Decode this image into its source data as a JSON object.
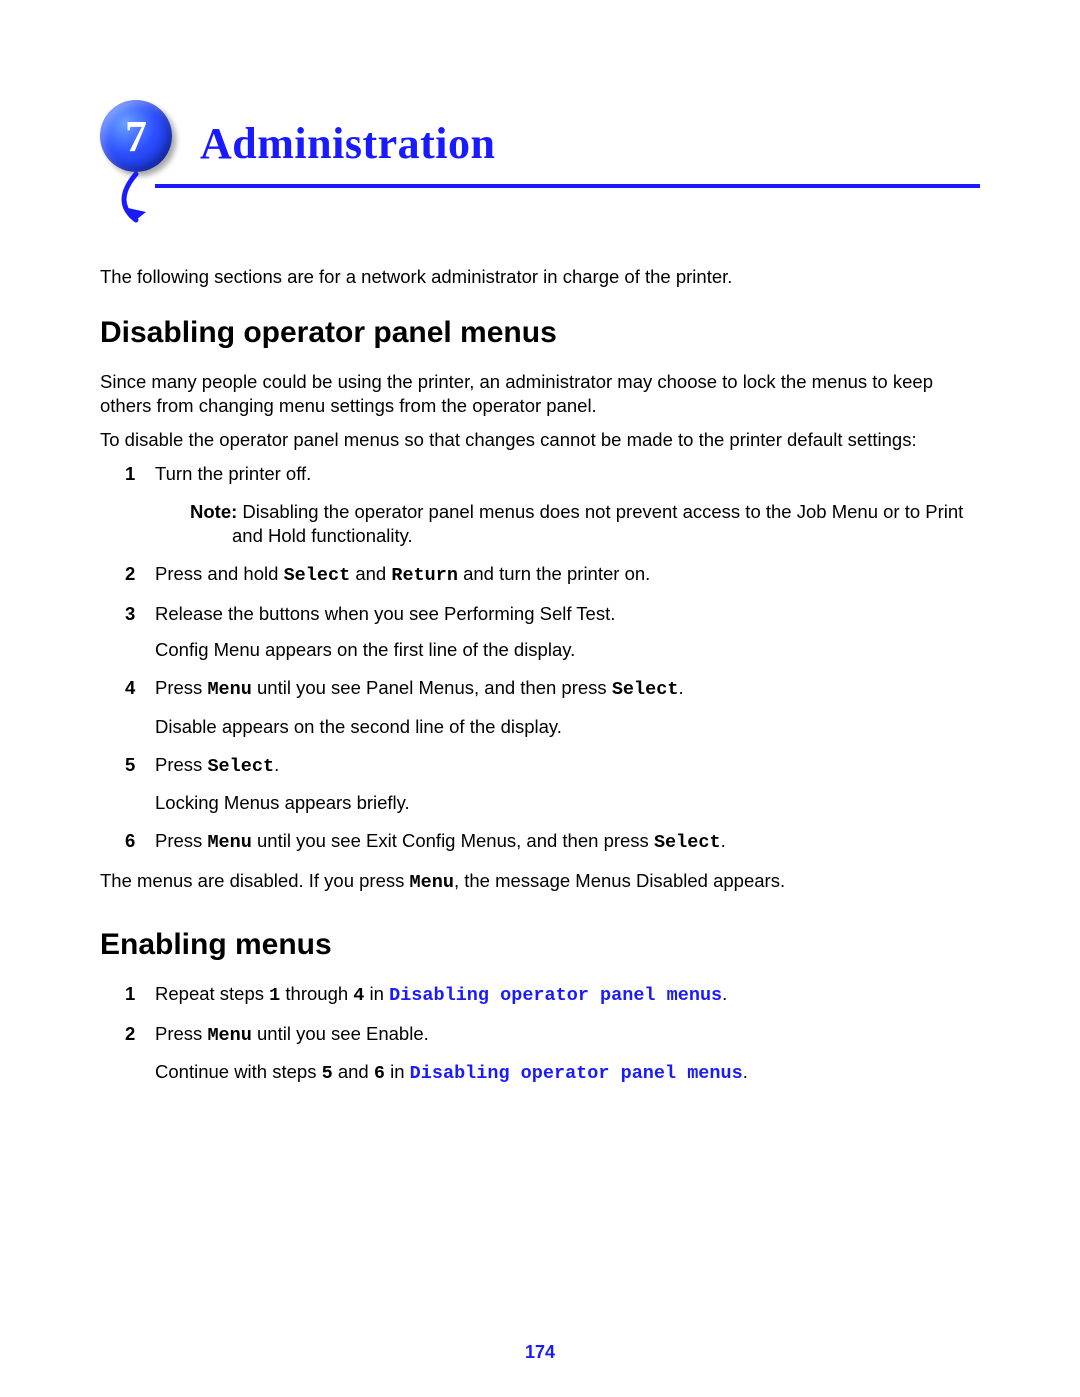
{
  "chapter": {
    "number": "7",
    "title": "Administration"
  },
  "intro": "The following sections are for a network administrator in charge of the printer.",
  "section1": {
    "heading": "Disabling operator panel menus",
    "para1": "Since many people could be using the printer, an administrator may choose to lock the menus to keep others from changing menu settings from the operator panel.",
    "para2": "To disable the operator panel menus so that changes cannot be made to the printer default settings:",
    "steps": {
      "s1": {
        "num": "1",
        "text": "Turn the printer off."
      },
      "note": {
        "label": "Note:",
        "text": " Disabling the operator panel menus does not prevent access to the Job Menu or to Print and Hold functionality."
      },
      "s2": {
        "num": "2",
        "pre": "Press and hold ",
        "k1": "Select",
        "mid": " and ",
        "k2": "Return",
        "post": " and turn the printer on."
      },
      "s3": {
        "num": "3",
        "pre": "Release the buttons when you see ",
        "msg": "Performing Self Test",
        "post": "."
      },
      "s3sub": "Config Menu appears on the first line of the display.",
      "s4": {
        "num": "4",
        "pre": "Press ",
        "k1": "Menu",
        "mid": " until you see ",
        "msg": "Panel Menus",
        "mid2": ", and then press ",
        "k2": "Select",
        "post": "."
      },
      "s4sub": "Disable appears on the second line of the display.",
      "s5": {
        "num": "5",
        "pre": "Press ",
        "k1": "Select",
        "post": "."
      },
      "s5sub_pre": "Locking Menus",
      "s5sub_post": " appears briefly.",
      "s6": {
        "num": "6",
        "pre": "Press ",
        "k1": "Menu",
        "mid": " until you see Exit Config Menus, and then press ",
        "k2": "Select",
        "post": "."
      }
    },
    "closing": {
      "pre": "The menus are disabled. If you press ",
      "k1": "Menu",
      "mid": ", the message ",
      "msg": "Menus Disabled",
      "post": " appears."
    }
  },
  "section2": {
    "heading": "Enabling menus",
    "steps": {
      "s1": {
        "num": "1",
        "pre": "Repeat steps ",
        "n1": "1",
        "mid": " through ",
        "n2": "4",
        "mid2": " in ",
        "link": "Disabling operator panel menus",
        "post": "."
      },
      "s2": {
        "num": "2",
        "pre": "Press ",
        "k1": "Menu",
        "post": " until you see Enable."
      },
      "s2sub": {
        "pre": "Continue with steps ",
        "n1": "5",
        "mid": " and ",
        "n2": "6",
        "mid2": " in ",
        "link": "Disabling operator panel menus",
        "post": "."
      }
    }
  },
  "page_number": "174"
}
